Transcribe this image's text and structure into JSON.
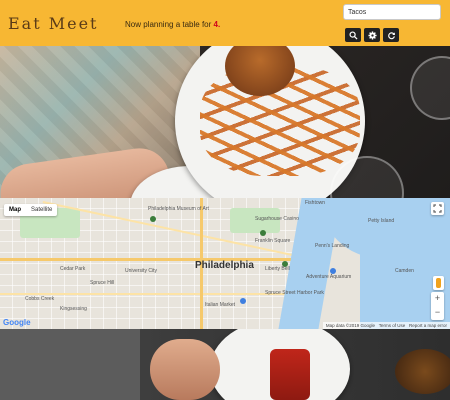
{
  "header": {
    "logo": "Eat Meet",
    "tagline_prefix": "Now planning a table for",
    "table_size": "4.",
    "search_value": "Tacos",
    "buttons": [
      "search-icon",
      "gear-icon",
      "refresh-icon"
    ]
  },
  "map": {
    "type_options": [
      "Map",
      "Satellite"
    ],
    "selected_type": "Map",
    "city": "Philadelphia",
    "labels": [
      "Philadelphia Museum of Art",
      "Franklin Square",
      "Sugarhouse Casino",
      "Penn's Landing",
      "Liberty Bell",
      "Adventure Aquarium",
      "Camden",
      "Spruce Street Harbor Park",
      "Italian Market",
      "University City",
      "Cobbs Creek",
      "Kingsessing",
      "Cedar Park",
      "Petty Island",
      "Fishtown",
      "Spruce Hill"
    ],
    "attribution": [
      "Map data ©2019 Google",
      "Terms of Use",
      "Report a map error"
    ],
    "provider": "Google"
  },
  "colors": {
    "header_bg": "#f7b733",
    "accent": "#d0021b"
  }
}
